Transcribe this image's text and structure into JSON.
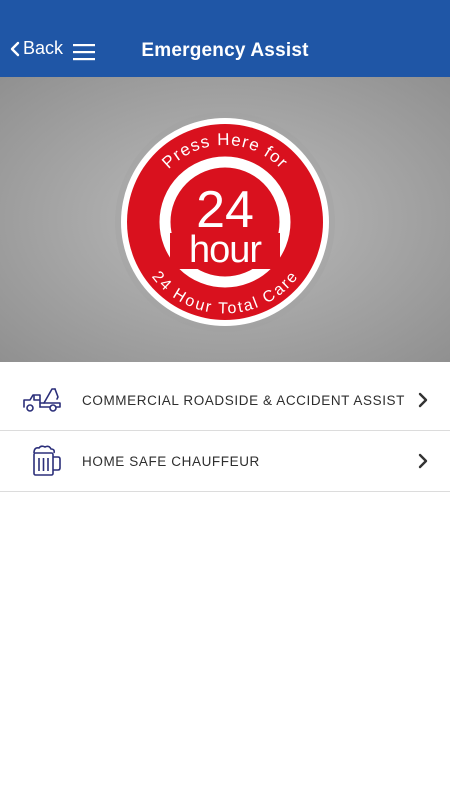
{
  "header": {
    "back_label": "Back",
    "title": "Emergency Assist"
  },
  "hero": {
    "arc_top": "Press Here for",
    "big_number": "24",
    "big_word": "hour",
    "arc_bottom": "24 Hour Total Care"
  },
  "list": {
    "items": [
      {
        "label": "COMMERCIAL ROADSIDE & ACCIDENT ASSIST",
        "icon": "tow-truck-icon"
      },
      {
        "label": "HOME SAFE CHAUFFEUR",
        "icon": "beer-mug-icon"
      }
    ]
  },
  "colors": {
    "header_bg": "#1f56a6",
    "badge_red": "#d9111e",
    "icon_navy": "#2b2f7a"
  }
}
